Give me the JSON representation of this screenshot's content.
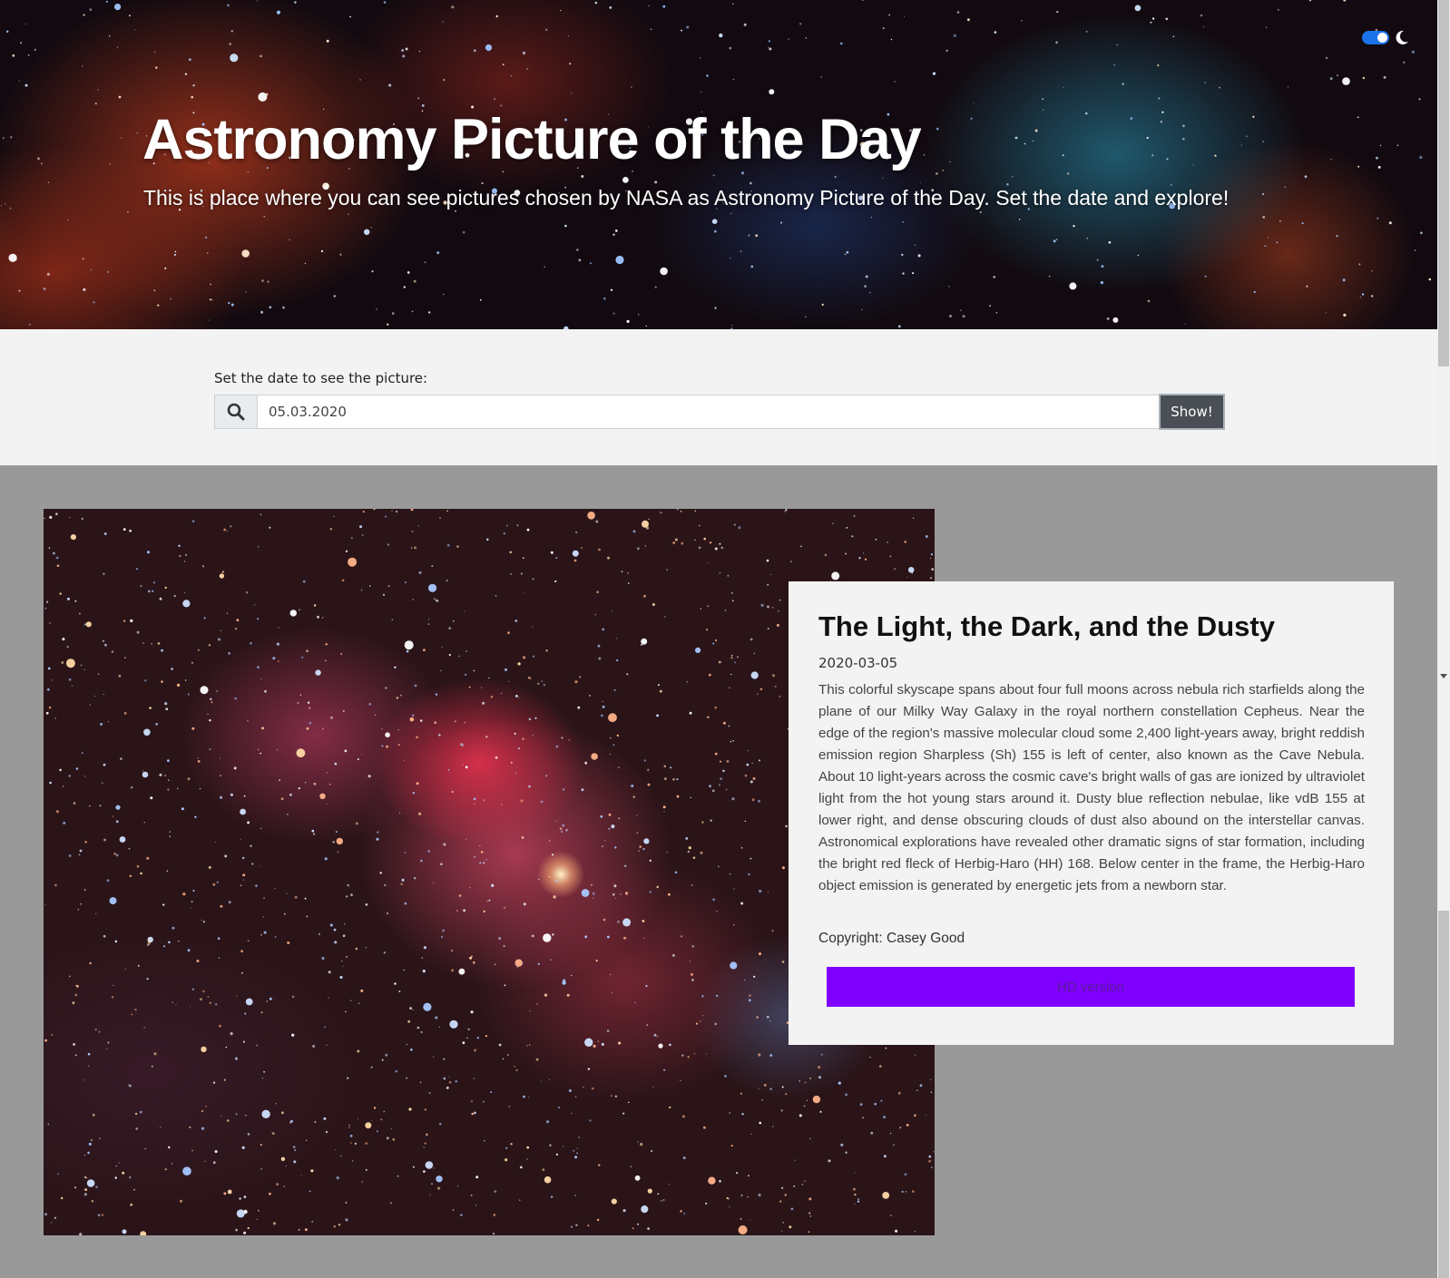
{
  "header": {
    "title": "Astronomy Picture of the Day",
    "subtitle": "This is place where you can see pictures chosen by NASA as Astronomy Picture of the Day. Set the date and explore!",
    "theme_toggle_on": true,
    "theme_icon": "moon-icon",
    "toggle_color": "#1a73e8"
  },
  "search": {
    "label": "Set the date to see the picture:",
    "date_value": "05.03.2020",
    "button_label": "Show!",
    "icon": "search-icon"
  },
  "apod": {
    "title": "The Light, the Dark, and the Dusty",
    "date": "2020-03-05",
    "explanation": "This colorful skyscape spans about four full moons across nebula rich starfields along the plane of our Milky Way Galaxy in the royal northern constellation Cepheus. Near the edge of the region's massive molecular cloud some 2,400 light-years away, bright reddish emission region Sharpless (Sh) 155 is left of center, also known as the Cave Nebula. About 10 light-years across the cosmic cave's bright walls of gas are ionized by ultraviolet light from the hot young stars around it. Dusty blue reflection nebulae, like vdB 155 at lower right, and dense obscuring clouds of dust also abound on the interstellar canvas. Astronomical explorations have revealed other dramatic signs of star formation, including the bright red fleck of Herbig-Haro (HH) 168. Below center in the frame, the Herbig-Haro object emission is generated by energetic jets from a newborn star.",
    "copyright": "Copyright: Casey Good",
    "hd_button_label": "HD version",
    "hd_button_color": "#8000ff"
  },
  "colors": {
    "search_section_bg": "#f3f3f3",
    "content_bg": "#999999",
    "card_bg": "#f3f3f3",
    "show_button_bg": "#4a4f55"
  }
}
